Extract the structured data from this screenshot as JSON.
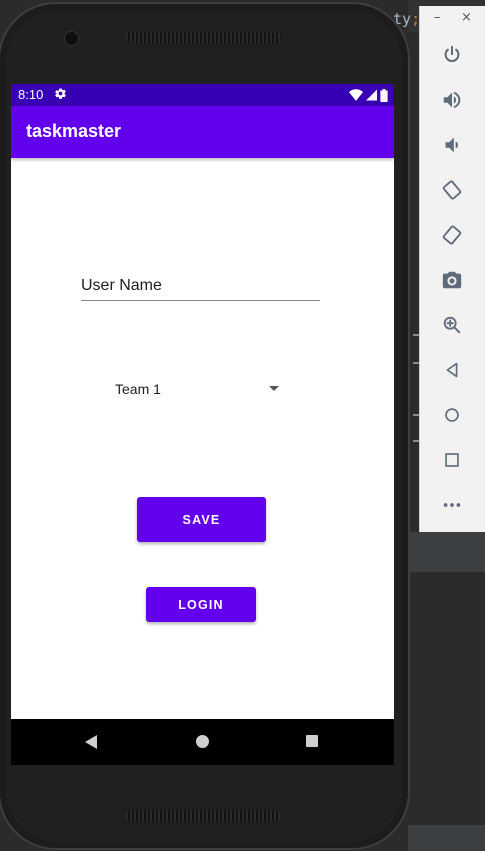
{
  "ide": {
    "code_fragment": "ty",
    "code_suffix": ";"
  },
  "statusbar": {
    "time": "8:10"
  },
  "app": {
    "title": "taskmaster",
    "username_placeholder": "User Name",
    "username_value": "",
    "team_selected": "Team 1",
    "save_label": "SAVE",
    "login_label": "LOGIN"
  },
  "emulator_toolbar": {
    "minimize": "–",
    "close": "×"
  },
  "colors": {
    "primary": "#6200ee",
    "primary_dark": "#3700b3",
    "nav_bg": "#000000",
    "toolbar_icon": "#5f6b7a"
  }
}
